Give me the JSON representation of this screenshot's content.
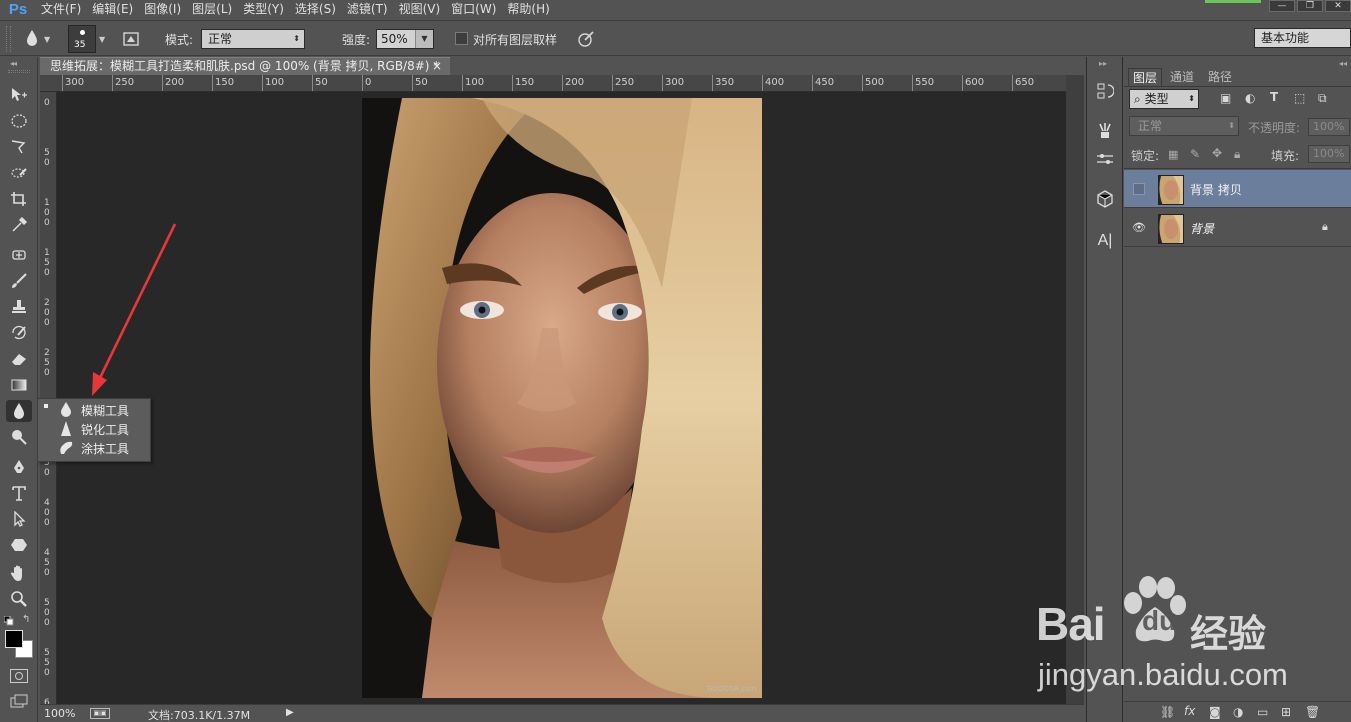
{
  "app": {
    "logo": "Ps"
  },
  "menu": [
    "文件(F)",
    "编辑(E)",
    "图像(I)",
    "图层(L)",
    "类型(Y)",
    "选择(S)",
    "滤镜(T)",
    "视图(V)",
    "窗口(W)",
    "帮助(H)"
  ],
  "window_controls": {
    "minimize": "—",
    "restore": "❐",
    "close": "✕"
  },
  "options": {
    "brush_size": "35",
    "mode_label": "模式:",
    "mode_value": "正常",
    "strength_label": "强度:",
    "strength_value": "50%",
    "sample_all_label": "对所有图层取样",
    "workspace": "基本功能"
  },
  "document": {
    "tab_title": "思维拓展：模糊工具打造柔和肌肤.psd @ 100% (背景 拷贝, RGB/8#) *",
    "close": "×",
    "ruler_top": [
      "300",
      "250",
      "200",
      "150",
      "100",
      "50",
      "0",
      "50",
      "100",
      "150",
      "200",
      "250",
      "300",
      "350",
      "400",
      "450",
      "500",
      "550",
      "600",
      "650"
    ],
    "ruler_left": [
      "0",
      "5\n0",
      "1\n0\n0",
      "1\n5\n0",
      "2\n0\n0",
      "2\n5\n0",
      "3\n0\n0",
      "3\n5\n0",
      "4\n0\n0",
      "4\n5\n0",
      "5\n0\n0",
      "5\n5\n0",
      "6\n0\n0"
    ],
    "photo_watermark": "GOOOGR.com"
  },
  "status": {
    "zoom": "100%",
    "doc_info": "文档:703.1K/1.37M"
  },
  "flyout": {
    "items": [
      {
        "label": "模糊工具",
        "icon": "blur-drop-icon",
        "selected": true
      },
      {
        "label": "锐化工具",
        "icon": "sharpen-triangle-icon",
        "selected": false
      },
      {
        "label": "涂抹工具",
        "icon": "smudge-finger-icon",
        "selected": false
      }
    ]
  },
  "layers_panel": {
    "tabs": [
      "图层",
      "通道",
      "路径"
    ],
    "filter_label": "类型",
    "blend_mode": "正常",
    "opacity_label": "不透明度:",
    "opacity_value": "100%",
    "lock_label": "锁定:",
    "fill_label": "填充:",
    "fill_value": "100%",
    "layers": [
      {
        "name": "背景 拷贝",
        "visible": false,
        "selected": true,
        "locked": false
      },
      {
        "name": "背景",
        "visible": true,
        "selected": false,
        "locked": true
      }
    ]
  },
  "watermark": {
    "brand": "Bai",
    "brand2": "du",
    "cn": "经验",
    "url": "jingyan.baidu.com"
  },
  "colors": {
    "accent": "#4ea2f5",
    "selected_layer": "#6b7e9b",
    "arrow": "#e8373a"
  }
}
